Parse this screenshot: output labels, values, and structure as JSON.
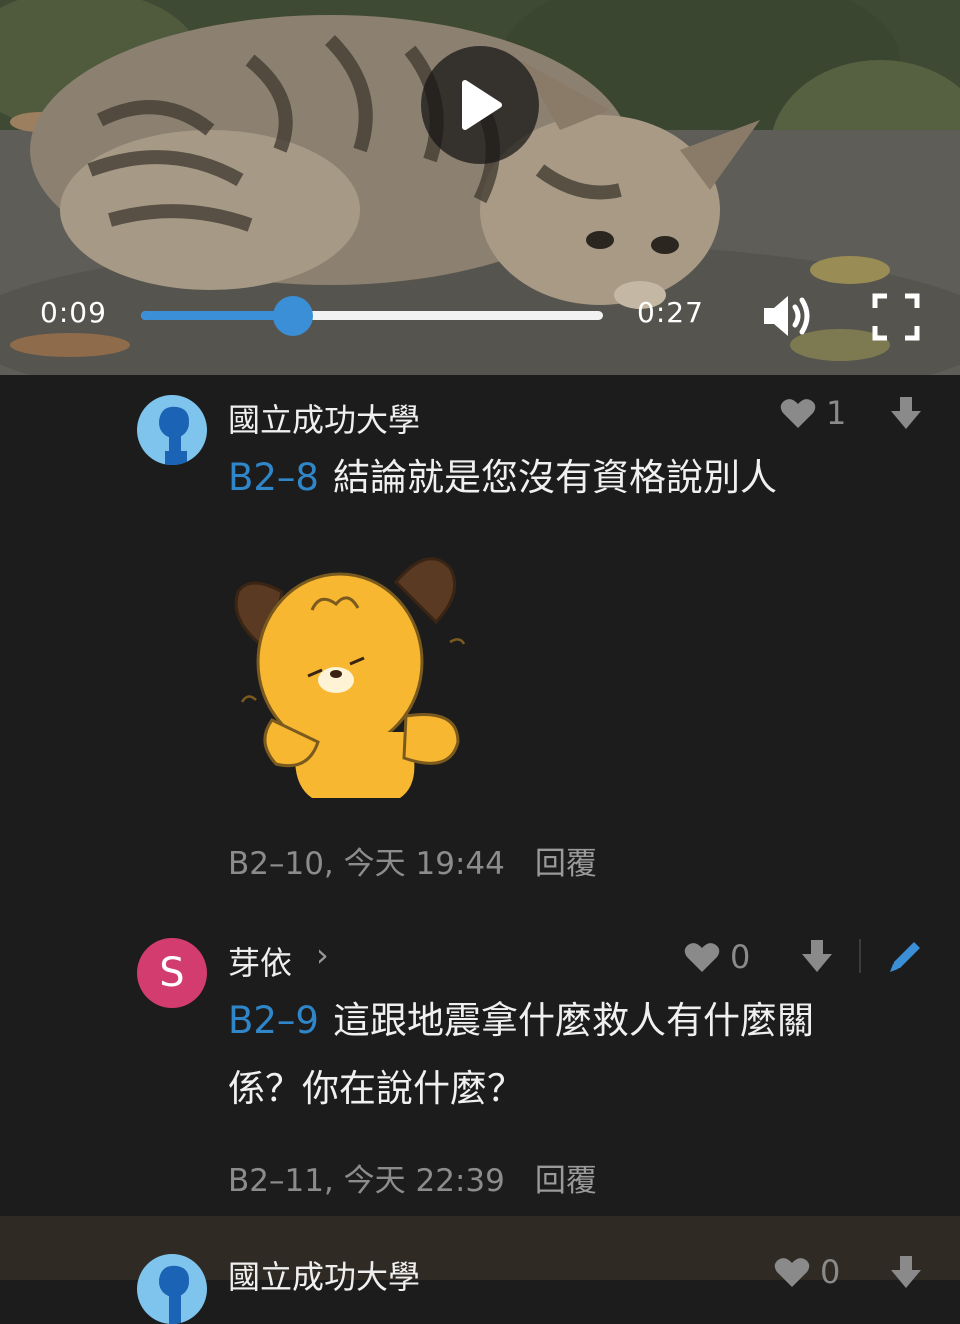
{
  "video": {
    "current_time": "0:09",
    "duration": "0:27",
    "progress": 0.33
  },
  "comments": [
    {
      "author": "國立成功大學",
      "likes": "1",
      "reply_to": "B2–8",
      "text": "結論就是您沒有資格說別人",
      "floor_time": "B2–10, 今天 19:44",
      "reply_label": "回覆",
      "has_sticker": true
    },
    {
      "author": "芽依",
      "avatar_letter": "S",
      "likes": "0",
      "reply_to": "B2–9",
      "text_line1": "這跟地震拿什麼救人有什麼關",
      "text_line2": "係？你在說什麼？",
      "floor_time": "B2–11, 今天 22:39",
      "reply_label": "回覆"
    },
    {
      "author": "國立成功大學",
      "likes": "0"
    }
  ],
  "colors": {
    "background": "#1c1c1c",
    "accent": "#3a8fd6",
    "avatar_pink": "#d23c6e"
  }
}
